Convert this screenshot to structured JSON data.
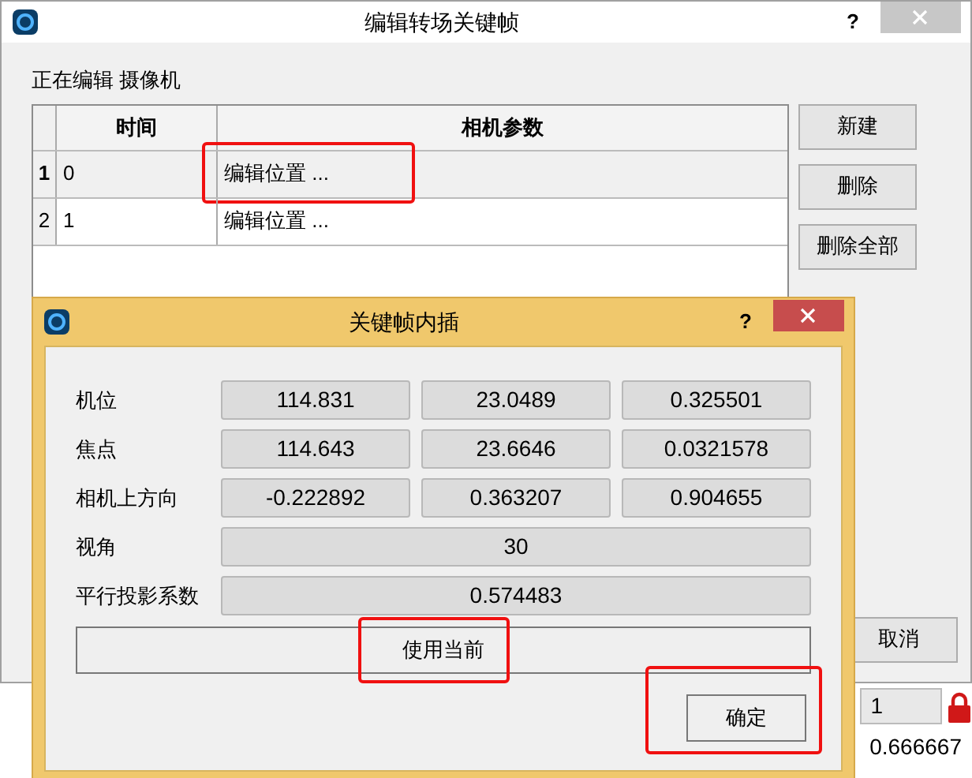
{
  "window": {
    "title": "编辑转场关键帧",
    "help": "?"
  },
  "editing_label": "正在编辑 摄像机",
  "table": {
    "columns": [
      "时间",
      "相机参数"
    ],
    "rows": [
      {
        "number": "1",
        "time": "0",
        "params": "编辑位置 ...",
        "selected": true,
        "highlighted": true
      },
      {
        "number": "2",
        "time": "1",
        "params": "编辑位置 ...",
        "selected": false,
        "highlighted": false
      }
    ]
  },
  "side_buttons": [
    "新建",
    "删除",
    "删除全部"
  ],
  "cancel_button": "取消",
  "bottom": {
    "field_value": "1",
    "reading": "0.666667"
  },
  "dialog": {
    "title": "关键帧内插",
    "help": "?",
    "rows": [
      {
        "label": "机位",
        "values": [
          "114.831",
          "23.0489",
          "0.325501"
        ]
      },
      {
        "label": "焦点",
        "values": [
          "114.643",
          "23.6646",
          "0.0321578"
        ]
      },
      {
        "label": "相机上方向",
        "values": [
          "-0.222892",
          "0.363207",
          "0.904655"
        ]
      },
      {
        "label": "视角",
        "values": [
          "30"
        ]
      },
      {
        "label": "平行投影系数",
        "values": [
          "0.574483"
        ]
      }
    ],
    "use_current": {
      "label": "使用当前",
      "highlighted": true
    },
    "ok": {
      "label": "确定",
      "highlighted": true
    }
  }
}
